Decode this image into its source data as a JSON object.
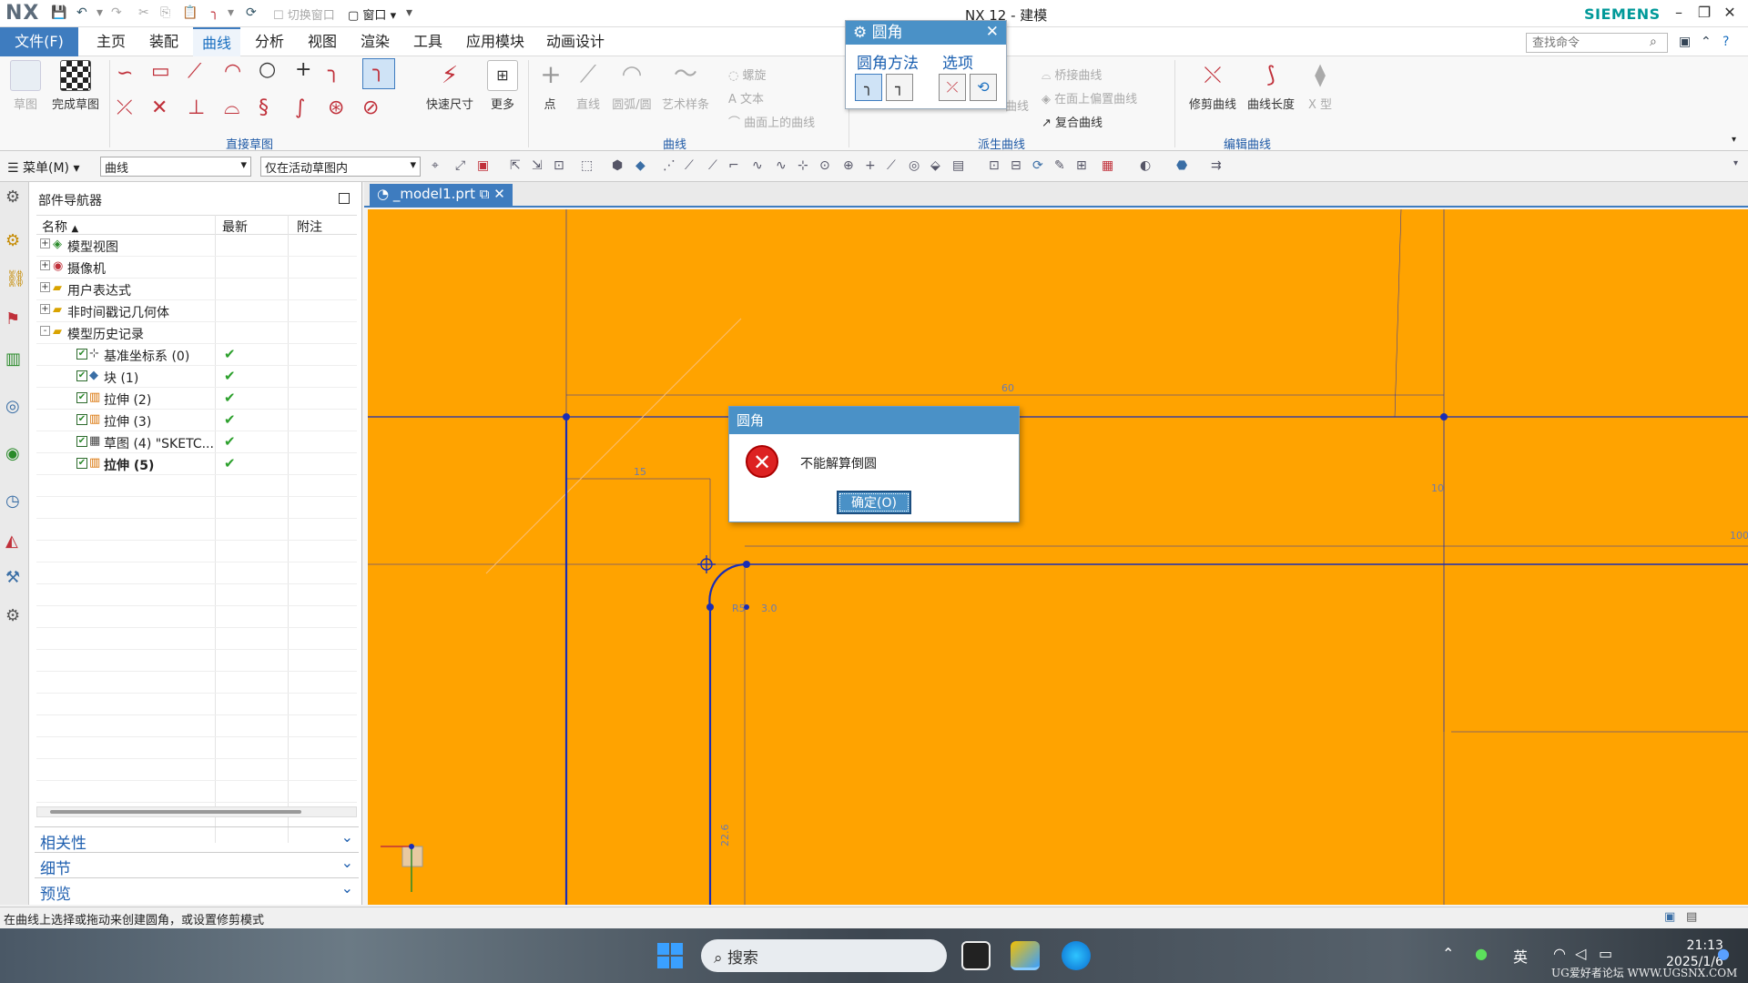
{
  "titlebar": {
    "logo": "NX",
    "title": "NX 12 - 建模",
    "switch_window": "切换窗口",
    "window_menu": "窗口",
    "brand": "SIEMENS"
  },
  "tabs": {
    "file": "文件(F)",
    "items": [
      "主页",
      "装配",
      "曲线",
      "分析",
      "视图",
      "渲染",
      "工具",
      "应用模块",
      "动画设计"
    ],
    "active": "曲线",
    "search_placeholder": "查找命令"
  },
  "ribbon": {
    "sketch": "草图",
    "finish_sketch": "完成草图",
    "rapid_dimension": "快速尺寸",
    "more": "更多",
    "point": "点",
    "line": "直线",
    "arc_circle": "圆弧/圆",
    "studio_spline": "艺术样条",
    "helix": "螺旋",
    "text": "文本",
    "curve_on_surface": "曲面上的曲线",
    "bridge_curve": "桥接曲线",
    "offset_on_face": "在面上偏置曲线",
    "composite_curve": "复合曲线",
    "trim_curve": "修剪曲线",
    "curve_length": "曲线长度",
    "x_type": "X 型",
    "derived_partial": "曲线",
    "groups": {
      "direct_sketch": "直接草图",
      "curve": "曲线",
      "derived_curve": "派生曲线",
      "edit_curve": "编辑曲线"
    }
  },
  "fillet_dialog": {
    "title": "圆角",
    "method_label": "圆角方法",
    "options_label": "选项"
  },
  "toolbar2": {
    "menu": "菜单(M)",
    "filter_value": "曲线",
    "scope_value": "仅在活动草图内"
  },
  "navigator": {
    "title": "部件导航器",
    "columns": [
      "名称",
      "最新",
      "附注"
    ],
    "rows": [
      {
        "label": "模型视图",
        "level": 0,
        "expander": "+",
        "check": false,
        "icon": "model-views-icon",
        "latest": false,
        "bold": false
      },
      {
        "label": "摄像机",
        "level": 0,
        "expander": "+",
        "check": false,
        "icon": "camera-icon",
        "latest": false,
        "bold": false
      },
      {
        "label": "用户表达式",
        "level": 0,
        "expander": "+",
        "check": false,
        "icon": "folder-icon",
        "latest": false,
        "bold": false
      },
      {
        "label": "非时间戳记几何体",
        "level": 0,
        "expander": "+",
        "check": false,
        "icon": "folder-icon",
        "latest": false,
        "bold": false
      },
      {
        "label": "模型历史记录",
        "level": 0,
        "expander": "-",
        "check": false,
        "icon": "folder-icon",
        "latest": false,
        "bold": false
      },
      {
        "label": "基准坐标系 (0)",
        "level": 1,
        "expander": "",
        "check": true,
        "icon": "datum-csys-icon",
        "latest": true,
        "bold": false
      },
      {
        "label": "块 (1)",
        "level": 1,
        "expander": "",
        "check": true,
        "icon": "block-icon",
        "latest": true,
        "bold": false
      },
      {
        "label": "拉伸 (2)",
        "level": 1,
        "expander": "",
        "check": true,
        "icon": "extrude-icon",
        "latest": true,
        "bold": false
      },
      {
        "label": "拉伸 (3)",
        "level": 1,
        "expander": "",
        "check": true,
        "icon": "extrude-icon",
        "latest": true,
        "bold": false
      },
      {
        "label": "草图 (4) \"SKETC...",
        "level": 1,
        "expander": "",
        "check": true,
        "icon": "sketch-icon",
        "latest": true,
        "bold": false
      },
      {
        "label": "拉伸 (5)",
        "level": 1,
        "expander": "",
        "check": true,
        "icon": "extrude-icon",
        "latest": true,
        "bold": true
      }
    ],
    "panels": [
      "相关性",
      "细节",
      "预览"
    ]
  },
  "document": {
    "tab_label": "_model1.prt"
  },
  "canvas": {
    "background": "#ffa300",
    "dims": [
      "60",
      "15",
      "R5",
      "3.0",
      "100",
      "10",
      "22.6"
    ]
  },
  "error_dialog": {
    "title": "圆角",
    "message": "不能解算倒圆",
    "ok_label": "确定(O)"
  },
  "statusbar": {
    "message": "在曲线上选择或拖动来创建圆角，或设置修剪模式"
  },
  "taskbar": {
    "search_label": "搜索",
    "ime": "英",
    "time": "21:13",
    "date": "2025/1/6",
    "watermark": "UG爱好者论坛 WWW.UGSNX.COM"
  },
  "colors": {
    "accent": "#3e7cbf",
    "canvas": "#ffa300",
    "sketch_line": "#1a2db5",
    "check": "#2ca02c",
    "error": "#dd2222"
  }
}
